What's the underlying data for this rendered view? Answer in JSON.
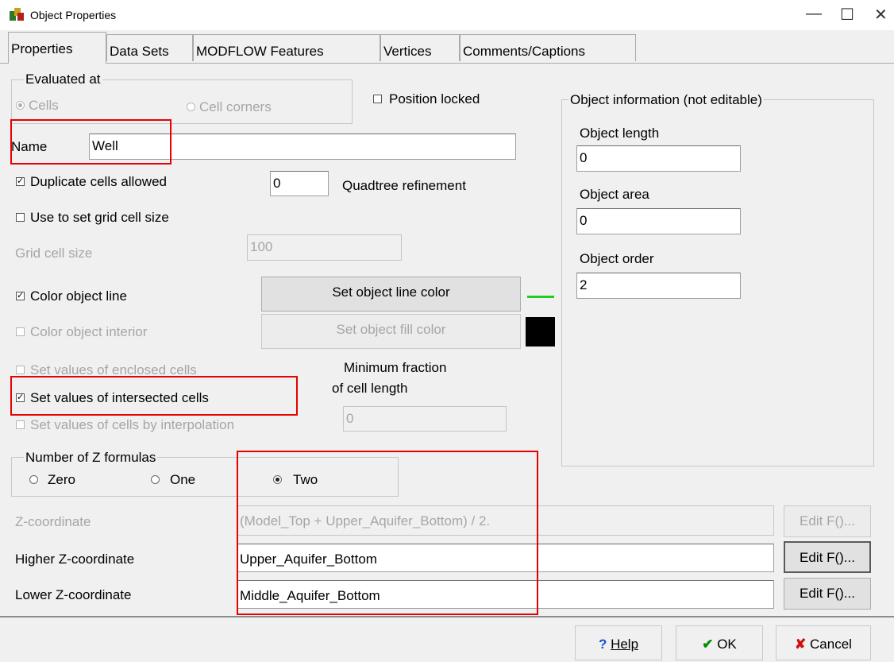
{
  "window": {
    "title": "Object Properties",
    "minimize": "—",
    "maximize": "☐",
    "close": "✕"
  },
  "tabs": [
    "Properties",
    "Data Sets",
    "MODFLOW Features",
    "Vertices",
    "Comments/Captions"
  ],
  "evaluated_at": {
    "label": "Evaluated at",
    "cells": "Cells",
    "cell_corners": "Cell corners",
    "selected": "Cells"
  },
  "position_locked": {
    "label": "Position locked",
    "checked": false
  },
  "name": {
    "label": "Name",
    "value": "Well"
  },
  "duplicate_cells": {
    "label": "Duplicate cells allowed",
    "checked": true
  },
  "quadtree": {
    "value": "0",
    "label": "Quadtree refinement"
  },
  "grid_cell_size_toggle": {
    "label": "Use to set grid cell size",
    "checked": false
  },
  "grid_cell_size": {
    "label": "Grid cell size",
    "value": "100"
  },
  "color_object_line": {
    "label": "Color object line",
    "checked": true,
    "button": "Set object line color",
    "color": "#22cc22"
  },
  "color_object_interior": {
    "label": "Color object interior",
    "checked": false,
    "button": "Set object fill color",
    "color": "#000000"
  },
  "enclosed_cells": {
    "label": "Set values of enclosed cells",
    "checked": false
  },
  "intersected_cells": {
    "label": "Set values of intersected cells",
    "checked": true
  },
  "interpolation_cells": {
    "label": "Set values of cells by interpolation",
    "checked": false
  },
  "min_fraction": {
    "label_line1": "Minimum fraction",
    "label_line2": "of cell length",
    "value": "0"
  },
  "object_info": {
    "label": "Object information (not editable)",
    "length_label": "Object length",
    "length_value": "0",
    "area_label": "Object area",
    "area_value": "0",
    "order_label": "Object order",
    "order_value": "2"
  },
  "z_formulas": {
    "label": "Number of Z formulas",
    "zero": "Zero",
    "one": "One",
    "two": "Two",
    "selected": "Two"
  },
  "z_coordinate": {
    "label": "Z-coordinate",
    "value": "(Model_Top + Upper_Aquifer_Bottom) / 2.",
    "button": "Edit F()..."
  },
  "higher_z": {
    "label": "Higher Z-coordinate",
    "value": "Upper_Aquifer_Bottom",
    "button": "Edit F()..."
  },
  "lower_z": {
    "label": "Lower Z-coordinate",
    "value": "Middle_Aquifer_Bottom",
    "button": "Edit F()..."
  },
  "footer": {
    "help": "Help",
    "help_icon": "?",
    "ok": "OK",
    "ok_icon": "✔",
    "cancel": "Cancel",
    "cancel_icon": "✘"
  },
  "annotation_color": "#e60000"
}
